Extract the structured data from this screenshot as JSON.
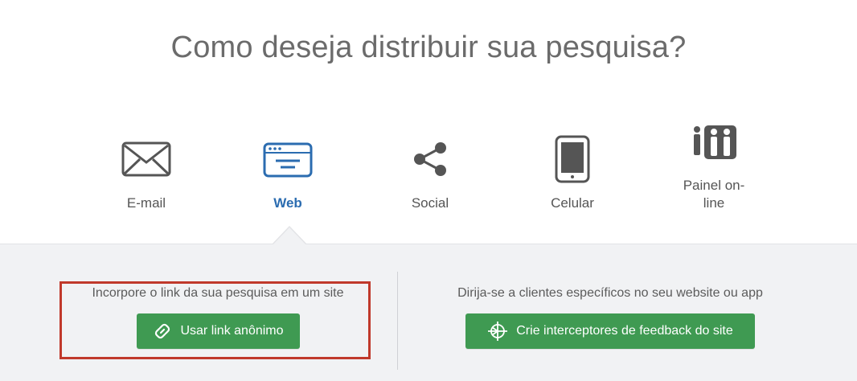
{
  "header": {
    "title": "Como deseja distribuir sua pesquisa?"
  },
  "options": [
    {
      "label": "E-mail",
      "icon": "envelope-icon",
      "active": false
    },
    {
      "label": "Web",
      "icon": "browser-window-icon",
      "active": true
    },
    {
      "label": "Social",
      "icon": "share-icon",
      "active": false
    },
    {
      "label": "Celular",
      "icon": "phone-icon",
      "active": false
    },
    {
      "label_line1": "Painel on-",
      "label_line2": "line",
      "icon": "people-panel-icon",
      "active": false
    }
  ],
  "left_section": {
    "description": "Incorpore o link da sua pesquisa em um site",
    "button_label": "Usar link anônimo",
    "button_icon": "link-icon"
  },
  "right_section": {
    "description": "Dirija-se a clientes específicos no seu website ou app",
    "button_label": "Crie interceptores de feedback do site",
    "button_icon": "crosshair-icon"
  },
  "colors": {
    "active": "#2b6cb0",
    "button": "#3f9a52",
    "highlight": "#c0392b",
    "panel": "#f1f2f4"
  }
}
